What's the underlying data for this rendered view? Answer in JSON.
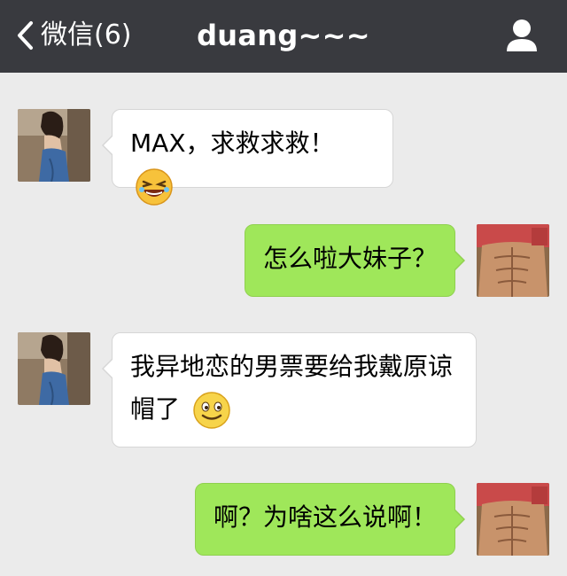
{
  "header": {
    "back_label": "微信(6)",
    "title": "duang~~~",
    "back_icon": "chevron-left-icon",
    "profile_icon": "person-icon",
    "bar_color": "#393a3f"
  },
  "messages": [
    {
      "side": "left",
      "text": "MAX，求救求救！",
      "emoji": "laughing-emoji-icon"
    },
    {
      "side": "right",
      "text": "怎么啦大妹子？"
    },
    {
      "side": "left",
      "text": "我异地恋的男票要给我戴原谅帽了",
      "emoji": "smiling-emoji-icon"
    },
    {
      "side": "right",
      "text": "啊？为啥这么说啊！"
    }
  ],
  "colors": {
    "background": "#ebebeb",
    "incoming_bubble": "#ffffff",
    "outgoing_bubble": "#9fe75a"
  }
}
